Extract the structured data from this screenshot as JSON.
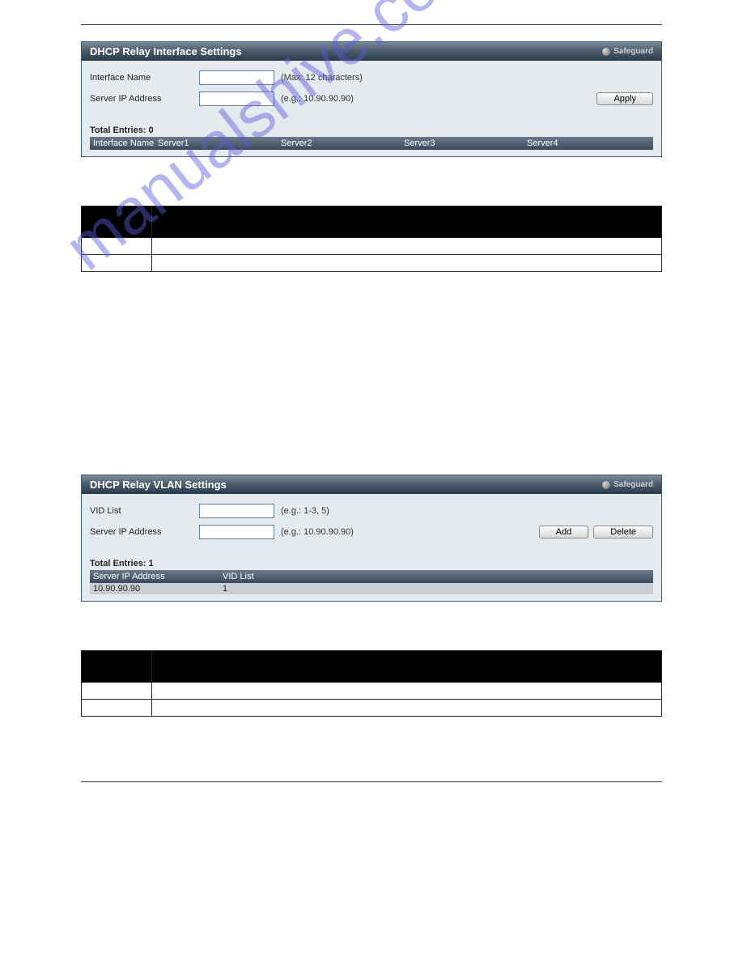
{
  "panel1": {
    "title": "DHCP Relay Interface Settings",
    "safeguard": "Safeguard",
    "rows": {
      "iface_label": "Interface Name",
      "iface_hint": "(Max: 12 characters)",
      "ip_label": "Server IP Address",
      "ip_hint": "(e.g.: 10.90.90.90)"
    },
    "apply": "Apply",
    "total_entries": "Total Entries: 0",
    "cols": {
      "c1": "Interface Name",
      "c2": "Server1",
      "c3": "Server2",
      "c4": "Server3",
      "c5": "Server4"
    }
  },
  "doctable1": {
    "h1": "",
    "h2": "",
    "r1c1": "",
    "r1c2": "",
    "r2c1": "",
    "r2c2": ""
  },
  "panel2": {
    "title": "DHCP Relay VLAN Settings",
    "safeguard": "Safeguard",
    "rows": {
      "vid_label": "VID List",
      "vid_hint": "(e.g.: 1-3, 5)",
      "ip_label": "Server IP Address",
      "ip_hint": "(e.g.: 10.90.90.90)"
    },
    "add": "Add",
    "delete": "Delete",
    "total_entries": "Total Entries: 1",
    "cols": {
      "c1": "Server IP Address",
      "c2": "VID List"
    },
    "data_row": {
      "ip": "10.90.90.90",
      "vid": "1"
    }
  },
  "doctable2": {
    "h1": "",
    "h2": "",
    "r1c1": "",
    "r1c2": "",
    "r2c1": "",
    "r2c2": ""
  },
  "watermark": "manualshive.com"
}
